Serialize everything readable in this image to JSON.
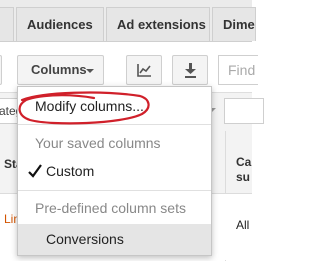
{
  "tabs": [
    {
      "label": ""
    },
    {
      "label": "Audiences"
    },
    {
      "label": "Ad extensions"
    },
    {
      "label": "Dime"
    }
  ],
  "toolbar": {
    "columns_label": "Columns",
    "chart_icon": "line-chart-icon",
    "download_icon": "download-icon",
    "search_placeholder": "Find"
  },
  "filter": {
    "select_label": "ategory"
  },
  "table": {
    "headers": {
      "status": "Sta",
      "right": "Ca su"
    },
    "row": {
      "link": "Lin bud",
      "right": "All"
    }
  },
  "menu": {
    "modify": "Modify columns...",
    "saved_label": "Your saved columns",
    "custom": "Custom",
    "custom_icon": "check-icon",
    "predefined_label": "Pre-defined column sets",
    "conversions": "Conversions"
  },
  "colors": {
    "annotation": "#d0202a",
    "link": "#d35400"
  }
}
